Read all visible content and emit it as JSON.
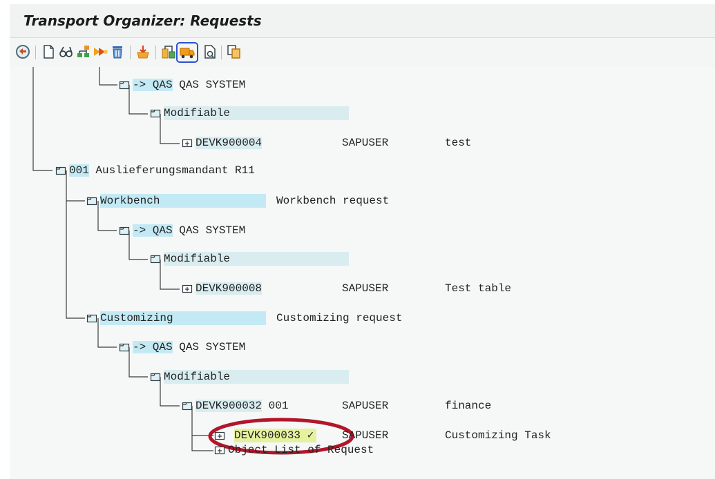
{
  "title": "Transport Organizer: Requests",
  "toolbar": {
    "icons": [
      "refresh-icon",
      "new-document-icon",
      "display-change-icon",
      "hierarchy-icon",
      "release-icon",
      "delete-icon",
      "import-icon",
      "structure-icon",
      "transport-truck-icon",
      "log-icon",
      "copy-icon"
    ],
    "active": "transport-truck-icon",
    "accent": "#2d4fd1"
  },
  "tree": {
    "n1": {
      "label": "-> QAS",
      "text": " QAS SYSTEM"
    },
    "n2": {
      "label": "Modifiable"
    },
    "n3": {
      "label": "DEVK900004",
      "owner": "SAPUSER",
      "desc": "test"
    },
    "n4": {
      "label": "001",
      "text": " Auslieferungsmandant R11"
    },
    "n5": {
      "label": "Workbench",
      "desc": "Workbench request"
    },
    "n6": {
      "label": "-> QAS",
      "text": " QAS SYSTEM"
    },
    "n7": {
      "label": "Modifiable"
    },
    "n8": {
      "label": "DEVK900008",
      "owner": "SAPUSER",
      "desc": "Test table"
    },
    "n9": {
      "label": "Customizing",
      "desc": "Customizing request"
    },
    "n10": {
      "label": "-> QAS",
      "text": " QAS SYSTEM"
    },
    "n11": {
      "label": "Modifiable"
    },
    "n12": {
      "label": "DEVK900032",
      "client": "001",
      "owner": "SAPUSER",
      "desc": "finance"
    },
    "n13": {
      "label": "DEVK900033",
      "mark": "✓",
      "owner": "SAPUSER",
      "desc": "Customizing Task"
    },
    "n14": {
      "label": "Object List of Request"
    }
  },
  "colors": {
    "highlight": "#c3eaf4",
    "selected": "#e6f19d",
    "annotation": "#b2162a"
  }
}
